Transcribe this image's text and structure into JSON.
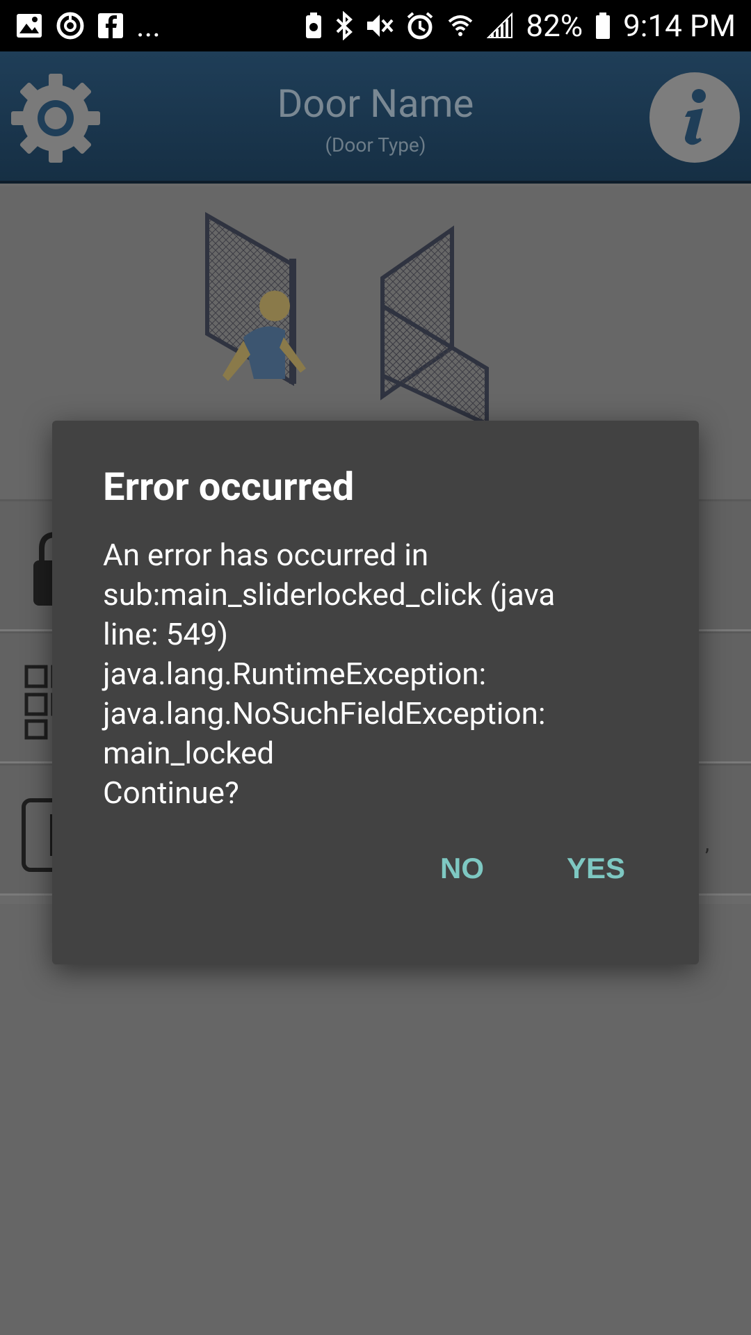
{
  "status_bar": {
    "left_icons": [
      "image-icon",
      "sync-icon",
      "facebook-icon"
    ],
    "more": "...",
    "right_icons": [
      "battery-saver-icon",
      "bluetooth-icon",
      "mute-icon",
      "alarm-icon",
      "wifi-icon",
      "signal-icon"
    ],
    "battery_percent": "82%",
    "time": "9:14 PM"
  },
  "header": {
    "title": "Door Name",
    "subtitle": "(Door Type)",
    "left_icon": "gear-icon",
    "right_icon": "info-icon"
  },
  "dialog": {
    "title": "Error occurred",
    "message": "An error has occurred in\nsub:main_sliderlocked_click (java\nline: 549)\njava.lang.RuntimeException:\njava.lang.NoSuchFieldException:\nmain_locked\nContinue?",
    "buttons": {
      "no": "NO",
      "yes": "YES"
    }
  },
  "background_rows": {
    "row3_peek": ","
  },
  "colors": {
    "header_bg": "#1f3e58",
    "dialog_bg": "#424242",
    "accent": "#7ec8c2"
  }
}
